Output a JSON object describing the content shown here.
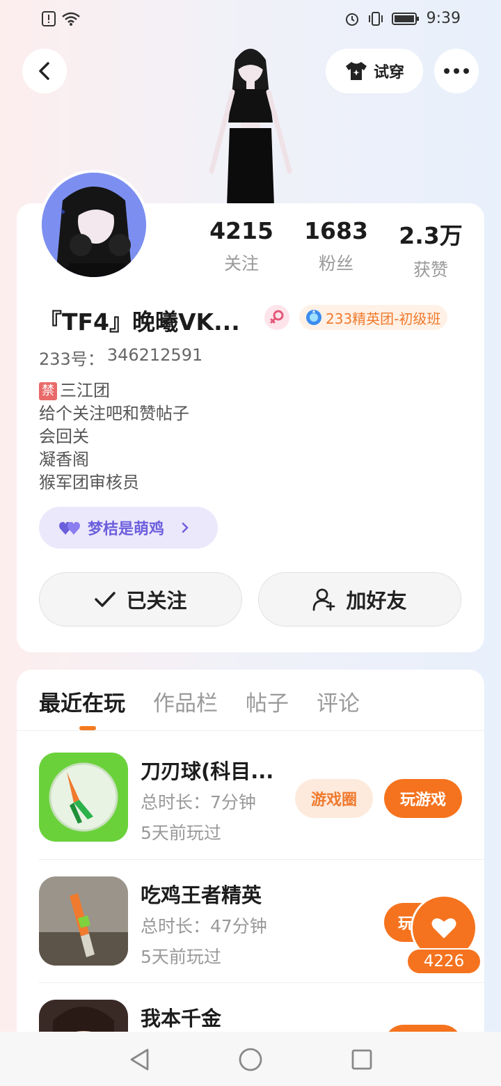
{
  "status_bar": {
    "time": "9:39"
  },
  "header": {
    "try_on_label": "试穿"
  },
  "profile": {
    "stats": [
      {
        "value": "4215",
        "label": "关注"
      },
      {
        "value": "1683",
        "label": "粉丝"
      },
      {
        "value": "2.3万",
        "label": "获赞"
      }
    ],
    "username": "『TF4』晚曦VK...",
    "rank_badge": "233精英团-初级班",
    "uid_label": "233号：",
    "uid_value": "346212591",
    "bio_tag": "禁",
    "bio_lines": [
      "三江团",
      "给个关注吧和赞帖子",
      "会回关",
      "凝香阁",
      "猴军团审核员"
    ],
    "cp_label": "梦桔是萌鸡",
    "follow_label": "已关注",
    "add_friend_label": "加好友"
  },
  "tabs": [
    "最近在玩",
    "作品栏",
    "帖子",
    "评论"
  ],
  "games": [
    {
      "name": "刀刃球(科目...",
      "duration": "总时长：7分钟",
      "last_played": "5天前玩过",
      "circle_label": "游戏圈",
      "play_label": "玩游戏"
    },
    {
      "name": "吃鸡王者精英",
      "duration": "总时长：47分钟",
      "last_played": "5天前玩过",
      "play_label": "玩"
    },
    {
      "name": "我本千金"
    }
  ],
  "like_fab": {
    "count": "4226"
  },
  "colors": {
    "accent": "#f5731e",
    "cp_purple": "#6c5fdc"
  }
}
